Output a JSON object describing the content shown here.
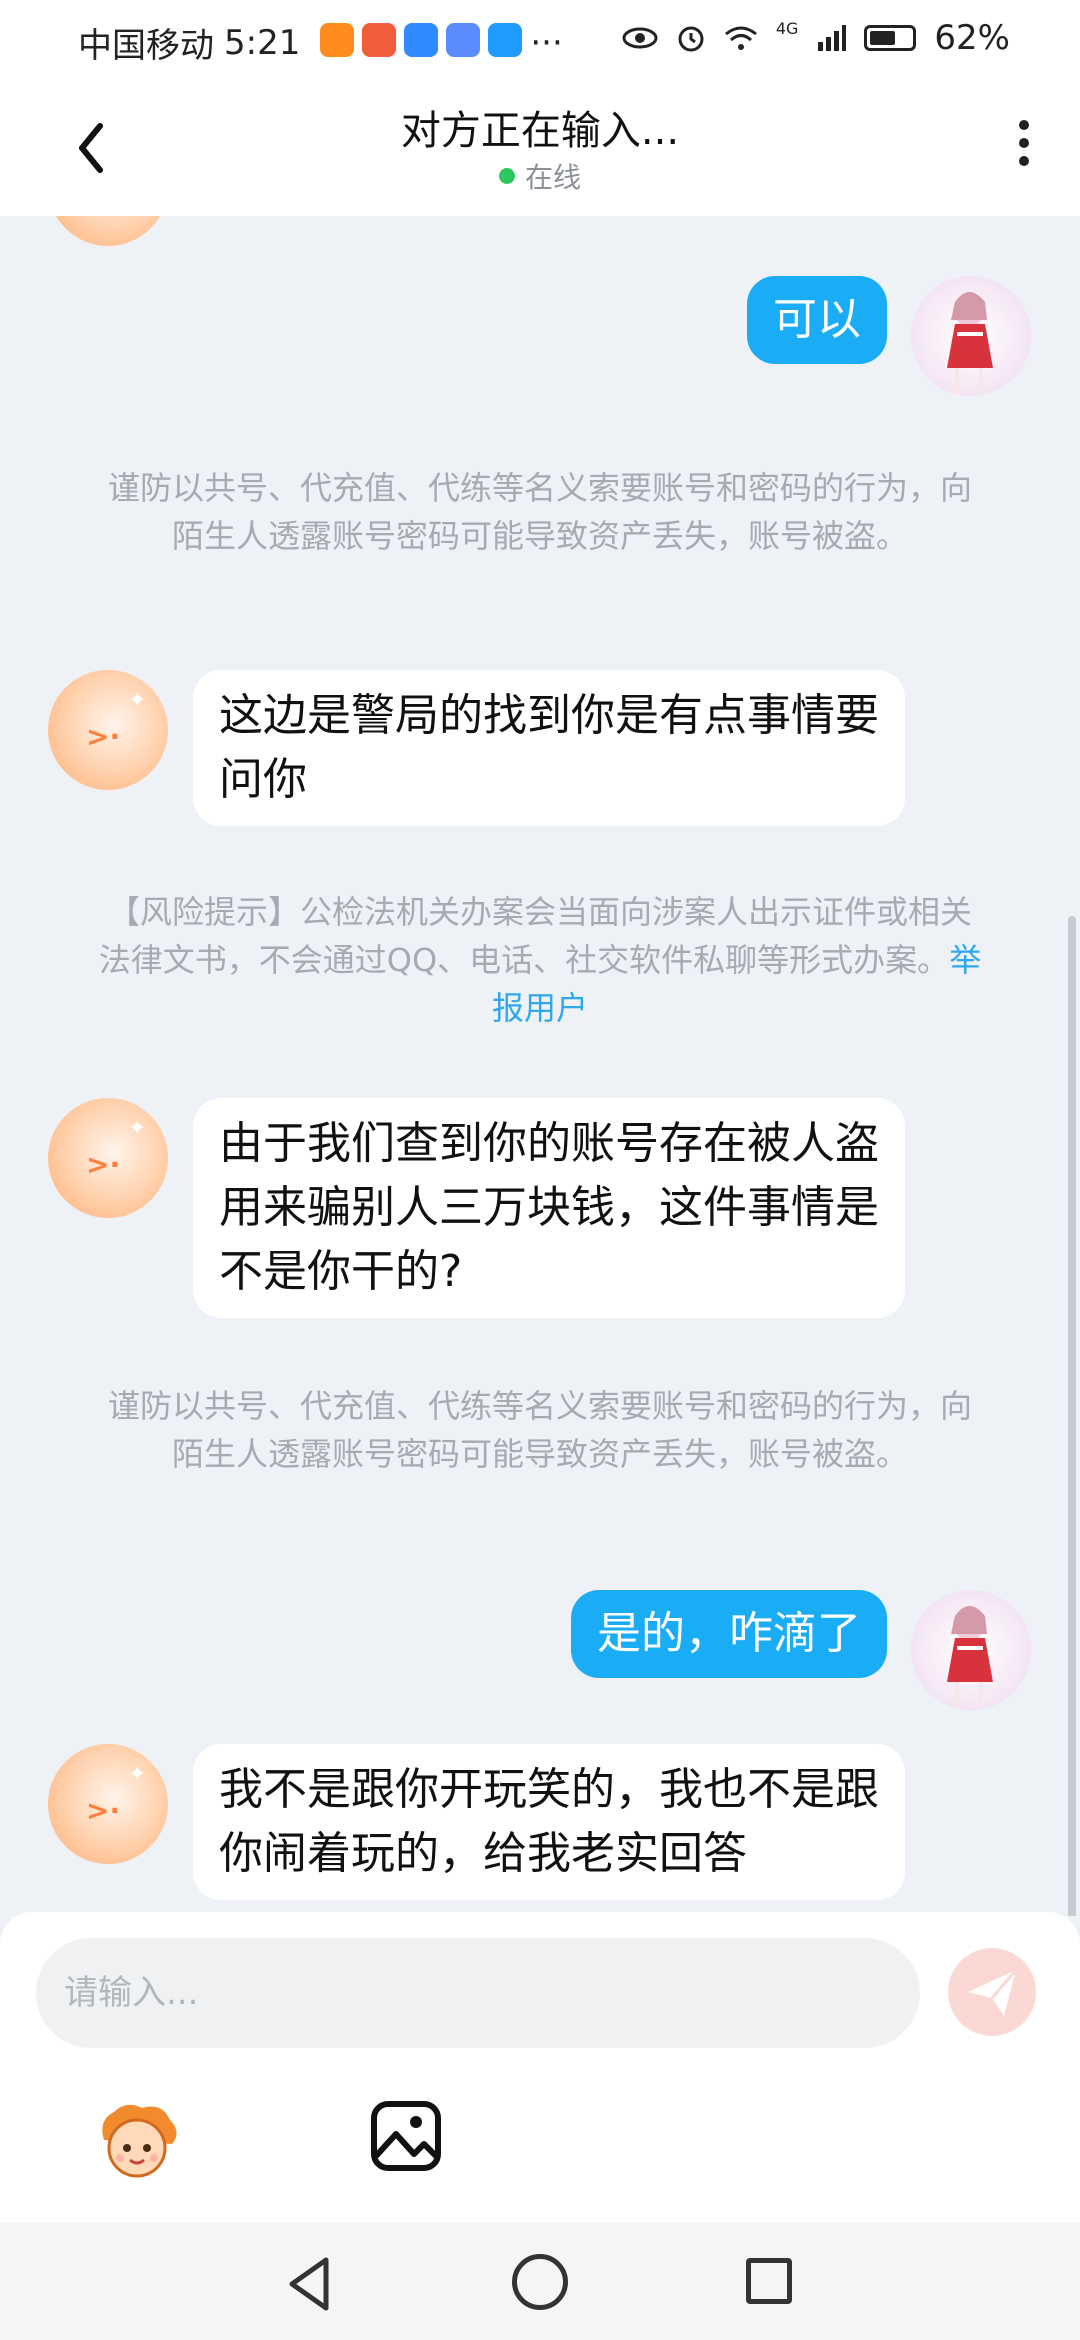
{
  "status_bar": {
    "carrier": "中国移动",
    "time": "5:21",
    "dots": "···",
    "network": "4G",
    "battery_percent": "62%",
    "battery_level": 0.62
  },
  "header": {
    "title": "对方正在输入...",
    "status": "在线"
  },
  "messages": {
    "m1": "可以",
    "notice1": "谨防以共号、代充值、代练等名义索要账号和密码的行为，向陌生人透露账号密码可能导致资产丢失，账号被盗。",
    "m2": "这边是警局的找到你是有点事情要问你",
    "notice2_text": "【风险提示】公检法机关办案会当面向涉案人出示证件或相关法律文书，不会通过QQ、电话、社交软件私聊等形式办案。",
    "notice2_link": "举报用户",
    "m3": "由于我们查到你的账号存在被人盗用来骗别人三万块钱，这件事情是不是你干的?",
    "notice3": "谨防以共号、代充值、代练等名义索要账号和密码的行为，向陌生人透露账号密码可能导致资产丢失，账号被盗。",
    "m4": "是的，咋滴了",
    "m5": "我不是跟你开玩笑的，我也不是跟你闹着玩的，给我老实回答"
  },
  "input": {
    "placeholder": "请输入..."
  },
  "colors": {
    "accent": "#1aadf6",
    "online": "#2bc95d",
    "link": "#2fa8ee"
  },
  "icons": [
    "back-arrow-icon",
    "more-icon",
    "send-icon",
    "emoji-icon",
    "image-icon",
    "nav-back-icon",
    "nav-home-icon",
    "nav-recent-icon"
  ]
}
